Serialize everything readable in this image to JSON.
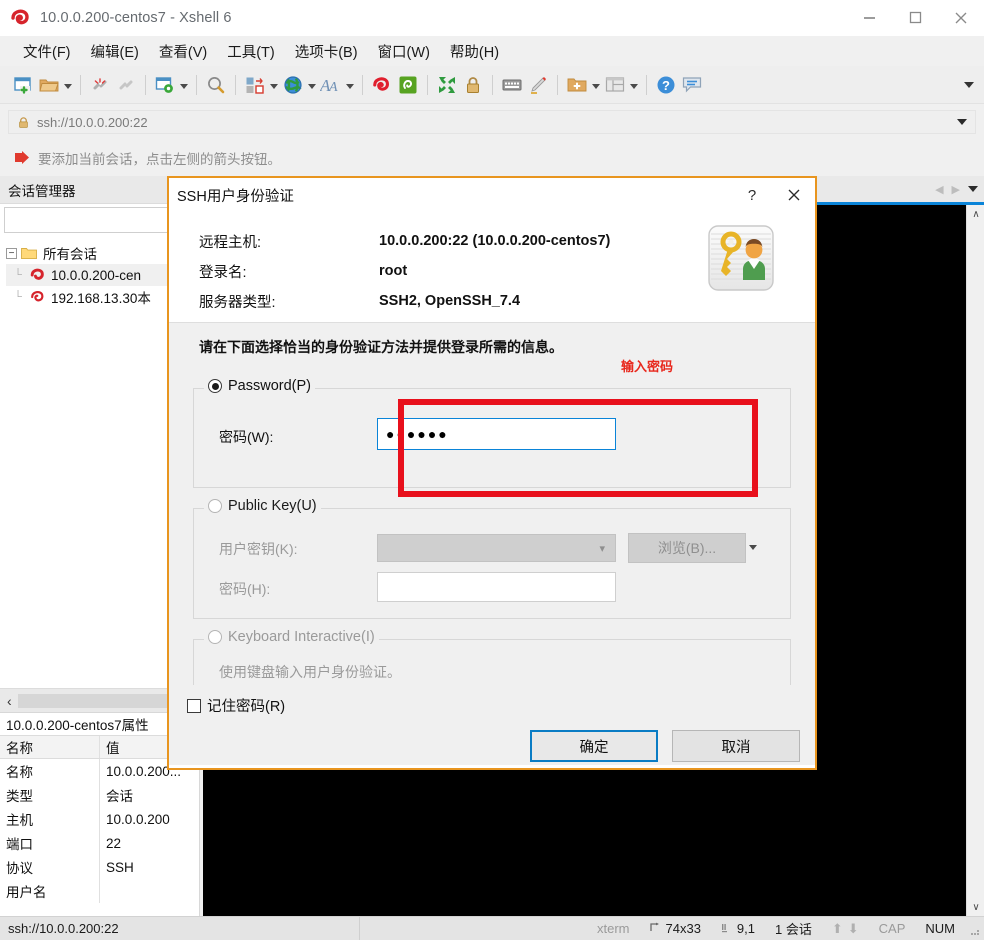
{
  "window": {
    "title": "10.0.0.200-centos7 - Xshell 6",
    "logo_icon": "xshell-logo-icon",
    "minimize_label": "—",
    "maximize_label": "☐",
    "close_label": "✕"
  },
  "menubar": {
    "items": [
      {
        "label": "文件(F)",
        "name": "menu-file"
      },
      {
        "label": "编辑(E)",
        "name": "menu-edit"
      },
      {
        "label": "查看(V)",
        "name": "menu-view"
      },
      {
        "label": "工具(T)",
        "name": "menu-tools"
      },
      {
        "label": "选项卡(B)",
        "name": "menu-tabs"
      },
      {
        "label": "窗口(W)",
        "name": "menu-window"
      },
      {
        "label": "帮助(H)",
        "name": "menu-help"
      }
    ]
  },
  "toolbar": {
    "icons": [
      "new-session-icon",
      "open-folder-icon",
      "disconnect-icon",
      "reconnect-icon",
      "session-properties-icon",
      "find-icon",
      "transfer-file-icon",
      "globe-icon",
      "font-icon",
      "xshell-icon",
      "xftp-icon",
      "fullscreen-icon",
      "lock-icon",
      "keyboard-icon",
      "highlight-icon",
      "add-folder-icon",
      "layout-icon",
      "help-icon",
      "comment-icon"
    ],
    "overflow_label": "▼"
  },
  "addressbar": {
    "lock_icon": "lock-icon",
    "url": "ssh://10.0.0.200:22",
    "dropdown_label": "▼"
  },
  "hint": {
    "arrow_icon": "red-arrow-icon",
    "text": "要添加当前会话，点击左侧的箭头按钮。"
  },
  "session_manager": {
    "header": "会话管理器",
    "search_value": "",
    "root": {
      "label": "所有会话",
      "expander": "−",
      "icon": "folder-icon"
    },
    "sessions": [
      {
        "label": "10.0.0.200-cen",
        "icon": "xshell-session-icon",
        "selected": true
      },
      {
        "label": "192.168.13.30本",
        "icon": "xshell-session-icon",
        "selected": false
      }
    ],
    "collapse_icon": "chevron-left-icon"
  },
  "properties": {
    "title": "10.0.0.200-centos7属性",
    "columns": [
      "名称",
      "值"
    ],
    "rows": [
      {
        "name": "名称",
        "value": "10.0.0.200..."
      },
      {
        "name": "类型",
        "value": "会话"
      },
      {
        "name": "主机",
        "value": "10.0.0.200"
      },
      {
        "name": "端口",
        "value": "22"
      },
      {
        "name": "协议",
        "value": "SSH"
      },
      {
        "name": "用户名",
        "value": ""
      }
    ]
  },
  "tabstrip": {
    "prev_label": "◀",
    "next_label": "▶",
    "dropdown_label": "▼"
  },
  "terminal": {
    "scroll_up": "∧",
    "scroll_down": "∨"
  },
  "statusbar": {
    "url": "ssh://10.0.0.200:22",
    "term_type": "xterm",
    "size_icon": "size-icon",
    "size": "74x33",
    "cursor_icon": "cursor-icon",
    "cursor": "9,1",
    "sessions": "1 会话",
    "up_arrow": "⬆",
    "down_arrow": "⬇",
    "cap": "CAP",
    "num": "NUM"
  },
  "dialog": {
    "title": "SSH用户身份验证",
    "help_label": "?",
    "close_label": "✕",
    "key_icon": "key-user-icon",
    "info": [
      {
        "label": "远程主机:",
        "value": "10.0.0.200:22 (10.0.0.200-centos7)"
      },
      {
        "label": "登录名:",
        "value": "root"
      },
      {
        "label": "服务器类型:",
        "value": "SSH2, OpenSSH_7.4"
      }
    ],
    "instruction": "请在下面选择恰当的身份验证方法并提供登录所需的信息。",
    "annotation": "输入密码",
    "annotation_color": "#e8271c",
    "highlight_color": "#e8101c",
    "password_group": {
      "legend": "Password(P)",
      "selected": true,
      "field_label": "密码(W):",
      "field_value": "●●●●●●"
    },
    "publickey_group": {
      "legend": "Public Key(U)",
      "selected": false,
      "userkey_label": "用户密钥(K):",
      "userkey_value": "",
      "browse_label": "浏览(B)...",
      "passphrase_label": "密码(H):",
      "passphrase_value": ""
    },
    "keyboard_group": {
      "legend": "Keyboard Interactive(I)",
      "selected": false,
      "description": "使用键盘输入用户身份验证。"
    },
    "remember_label": "记住密码(R)",
    "remember_checked": false,
    "ok_label": "确定",
    "cancel_label": "取消"
  }
}
